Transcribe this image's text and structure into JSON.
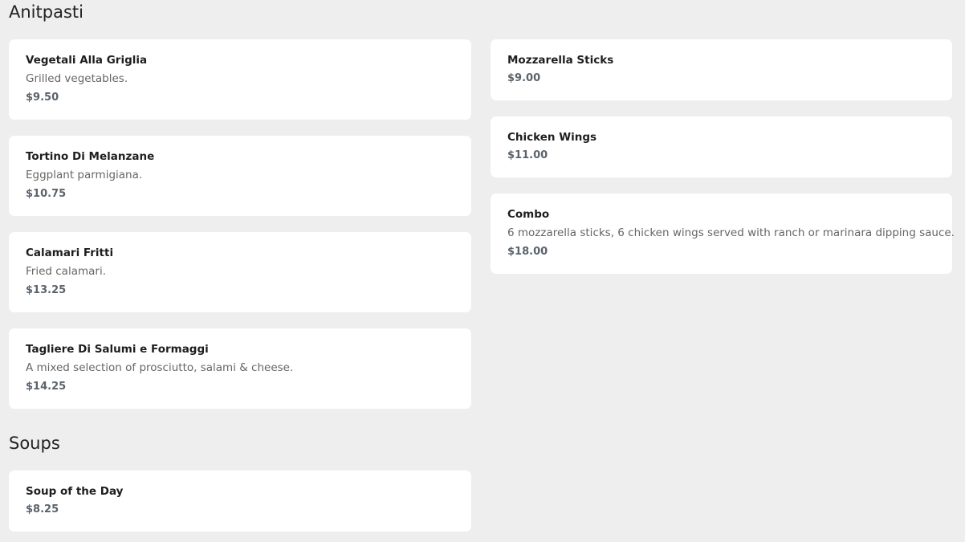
{
  "sections": {
    "antipasti": {
      "title": "Anitpasti",
      "items": [
        {
          "name": "Vegetali Alla Griglia",
          "description": "Grilled vegetables.",
          "price": "$9.50"
        },
        {
          "name": "Tortino Di Melanzane",
          "description": "Eggplant parmigiana.",
          "price": "$10.75"
        },
        {
          "name": "Calamari Fritti",
          "description": "Fried calamari.",
          "price": "$13.25"
        },
        {
          "name": "Tagliere Di Salumi e Formaggi",
          "description": "A mixed selection of prosciutto, salami & cheese.",
          "price": "$14.25"
        },
        {
          "name": "Mozzarella Sticks",
          "price": "$9.00"
        },
        {
          "name": "Chicken Wings",
          "price": "$11.00"
        },
        {
          "name": "Combo",
          "description": "6 mozzarella sticks, 6 chicken wings served with ranch or marinara dipping sauce.",
          "price": "$18.00"
        }
      ]
    },
    "soups": {
      "title": "Soups",
      "items": [
        {
          "name": "Soup of the Day",
          "price": "$8.25"
        }
      ]
    }
  }
}
